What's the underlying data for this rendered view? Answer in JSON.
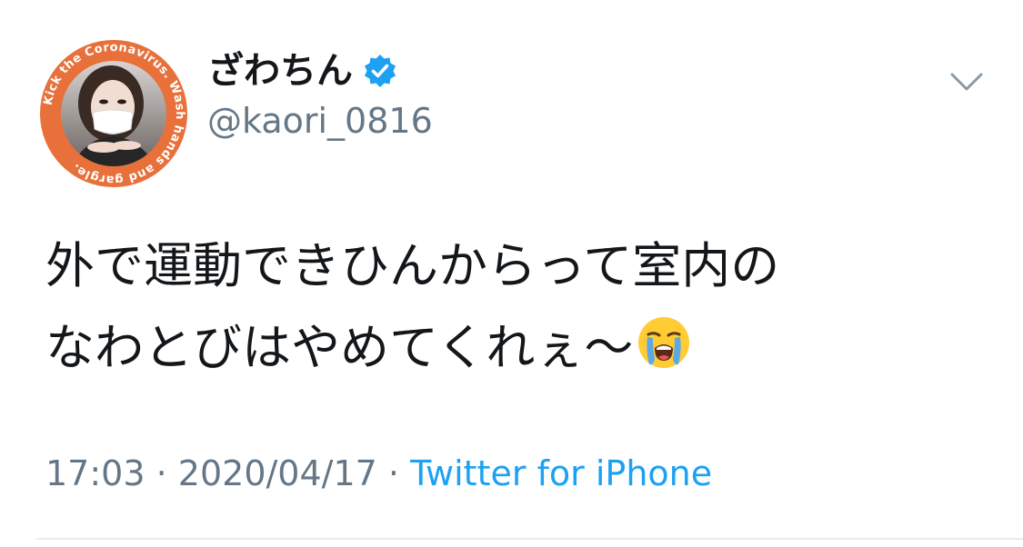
{
  "tweet": {
    "avatar": {
      "badge_text": "Kick the Coronavirus. Wash hands and gargle.",
      "ring_color": "#e8703a"
    },
    "display_name": "ざわちん",
    "handle": "@kaori_0816",
    "verified": true,
    "verified_icon": "verified-badge-icon",
    "verified_color": "#1da1f2",
    "menu_icon": "chevron-down-icon",
    "text_lines": [
      "外で運動できひんからって室内の",
      "なわとびはやめてくれぇ〜"
    ],
    "emoji": "loudly-crying-face-icon",
    "time": "17:03",
    "separator": "·",
    "date": "2020/04/17",
    "source": "Twitter for iPhone",
    "source_color": "#1da1f2"
  }
}
